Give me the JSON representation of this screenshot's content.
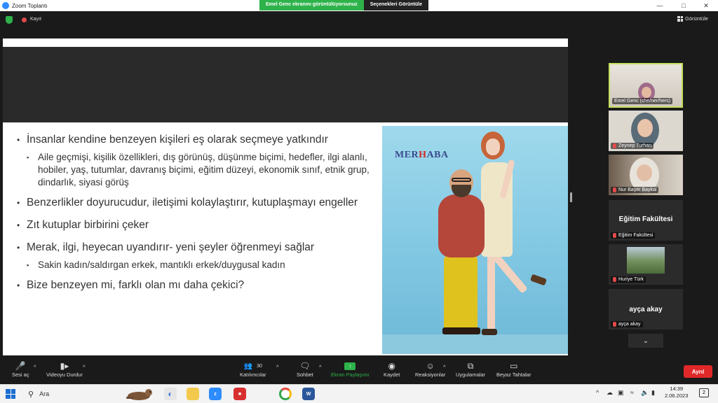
{
  "titlebar": {
    "app_title": "Zoom Toplantı",
    "share_notice": "Emel Genc ekranını görüntülüyorsunuz",
    "view_options": "Seçenekleri Görüntüle"
  },
  "top": {
    "recording_label": "Kayıt",
    "view_label": "Görüntüle"
  },
  "slide": {
    "bullets": [
      {
        "text": "İnsanlar kendine benzeyen kişileri eş olarak seçmeye yatkındır",
        "sub": [
          "Aile geçmişi, kişilik özellikleri, dış görünüş, düşünme biçimi, hedefler, ilgi alanlı, hobiler, yaş, tutumlar, davranış biçimi, eğitim düzeyi, ekonomik sınıf, etnik grup, dindarlık, siyasi görüş"
        ]
      },
      {
        "text": "Benzerlikler doyurucudur, iletişimi kolaylaştırır, kutuplaşmayı engeller",
        "sub": []
      },
      {
        "text": "Zıt kutuplar birbirini çeker",
        "sub": []
      },
      {
        "text": "Merak, ilgi, heyecan uyandırır- yeni şeyler öğrenmeyi sağlar",
        "sub": [
          "Sakin kadın/saldırgan erkek, mantıklı erkek/duygusal kadın"
        ]
      },
      {
        "text": "Bize benzeyen mi, farklı olan mı daha çekici?",
        "sub": []
      }
    ],
    "photo_brand_pre": "MER",
    "photo_brand_mid": "H",
    "photo_brand_post": "ABA"
  },
  "participants": [
    {
      "name": "Emel Genc (she/her/hers)",
      "active": true,
      "type": "video"
    },
    {
      "name": "Zeynep Turhan",
      "type": "video"
    },
    {
      "name": "Nur Başer Baykal",
      "type": "video"
    },
    {
      "name": "Eğitim Fakültesi",
      "display": "Eğitim Fakültesi",
      "type": "text"
    },
    {
      "name": "Huriye Türk",
      "type": "photo"
    },
    {
      "name": "ayça akay",
      "display": "ayça akay",
      "type": "text"
    }
  ],
  "toolbar": {
    "audio": "Sesi aç",
    "video": "Videoyu Durdur",
    "participants": "Katılımcılar",
    "participants_count": "30",
    "chat": "Sohbet",
    "share": "Ekran Paylaşımı",
    "record": "Kaydet",
    "reactions": "Reaksiyonlar",
    "apps": "Uygulamalar",
    "whiteboard": "Beyaz Tahtalar",
    "leave": "Ayrıl"
  },
  "taskbar": {
    "search_label": "Ara",
    "time": "14:39",
    "date": "2.06.2023",
    "notifications": "2"
  },
  "colors": {
    "share_green": "#2eb34a",
    "leave_red": "#e02828",
    "active_speaker": "#c4e05c"
  }
}
